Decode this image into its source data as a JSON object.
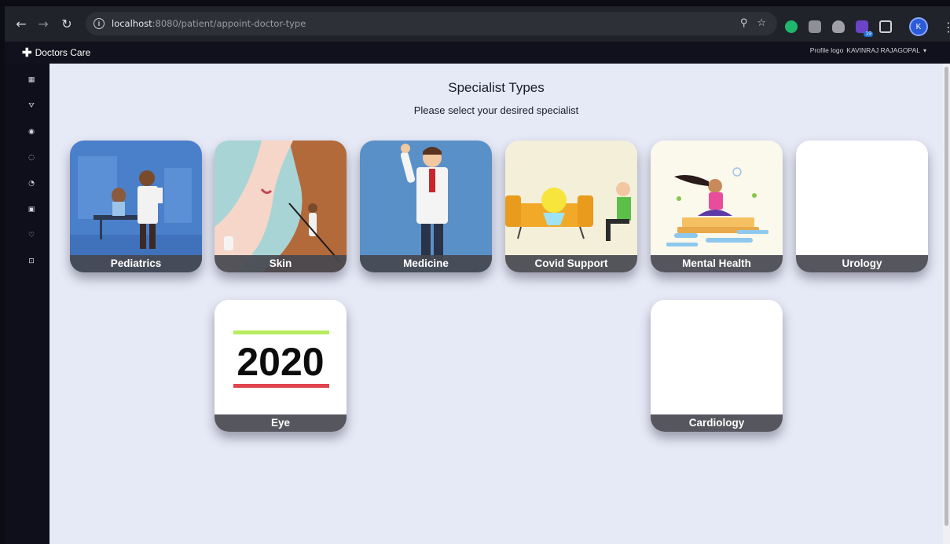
{
  "browser": {
    "url_host": "localhost",
    "url_rest": ":8080/patient/appoint-doctor-type",
    "avatar_letter": "K",
    "extension_badge": "19"
  },
  "app": {
    "brand": "Doctors Care",
    "profile_text": "Profile logo",
    "user_name": "KAVINRAJ RAJAGOPAL"
  },
  "page": {
    "title": "Specialist Types",
    "subtitle": "Please select your desired specialist"
  },
  "eye_card_text": "2020",
  "specialists": [
    {
      "name": "Pediatrics"
    },
    {
      "name": "Skin"
    },
    {
      "name": "Medicine"
    },
    {
      "name": "Covid Support"
    },
    {
      "name": "Mental Health"
    },
    {
      "name": "Urology"
    },
    {
      "name": "Eye"
    },
    {
      "name": "Cardiology"
    }
  ],
  "sidebar_icons": [
    "dashboard-icon",
    "filter-icon",
    "target-icon",
    "chat-icon",
    "clock-icon",
    "calendar-icon",
    "heart-icon",
    "logout-icon"
  ]
}
